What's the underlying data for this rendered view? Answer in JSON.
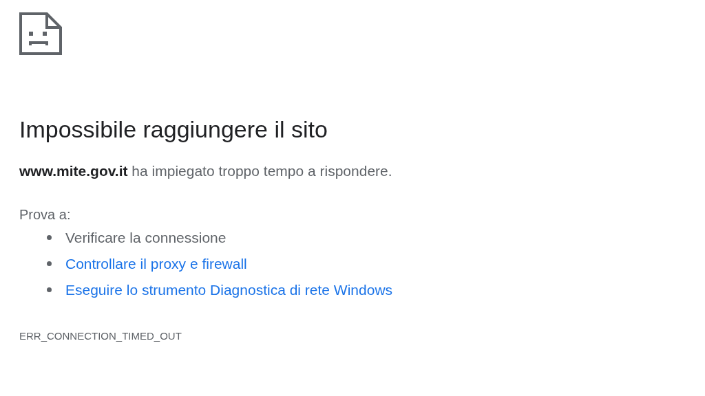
{
  "title": "Impossibile raggiungere il sito",
  "message": "**www.mite.gov.it** ha impiegato troppo tempo a rispondere.",
  "suggestions_label": "Prova a:",
  "suggestions": [
    {
      "text": "Verificare la connessione",
      "kind": "text"
    },
    {
      "text": "Controllare il proxy e firewall",
      "kind": "link"
    },
    {
      "text": "Eseguire lo strumento Diagnostica di rete Windows",
      "kind": "link"
    }
  ],
  "error_code": "ERR_CONNECTION_TIMED_OUT"
}
